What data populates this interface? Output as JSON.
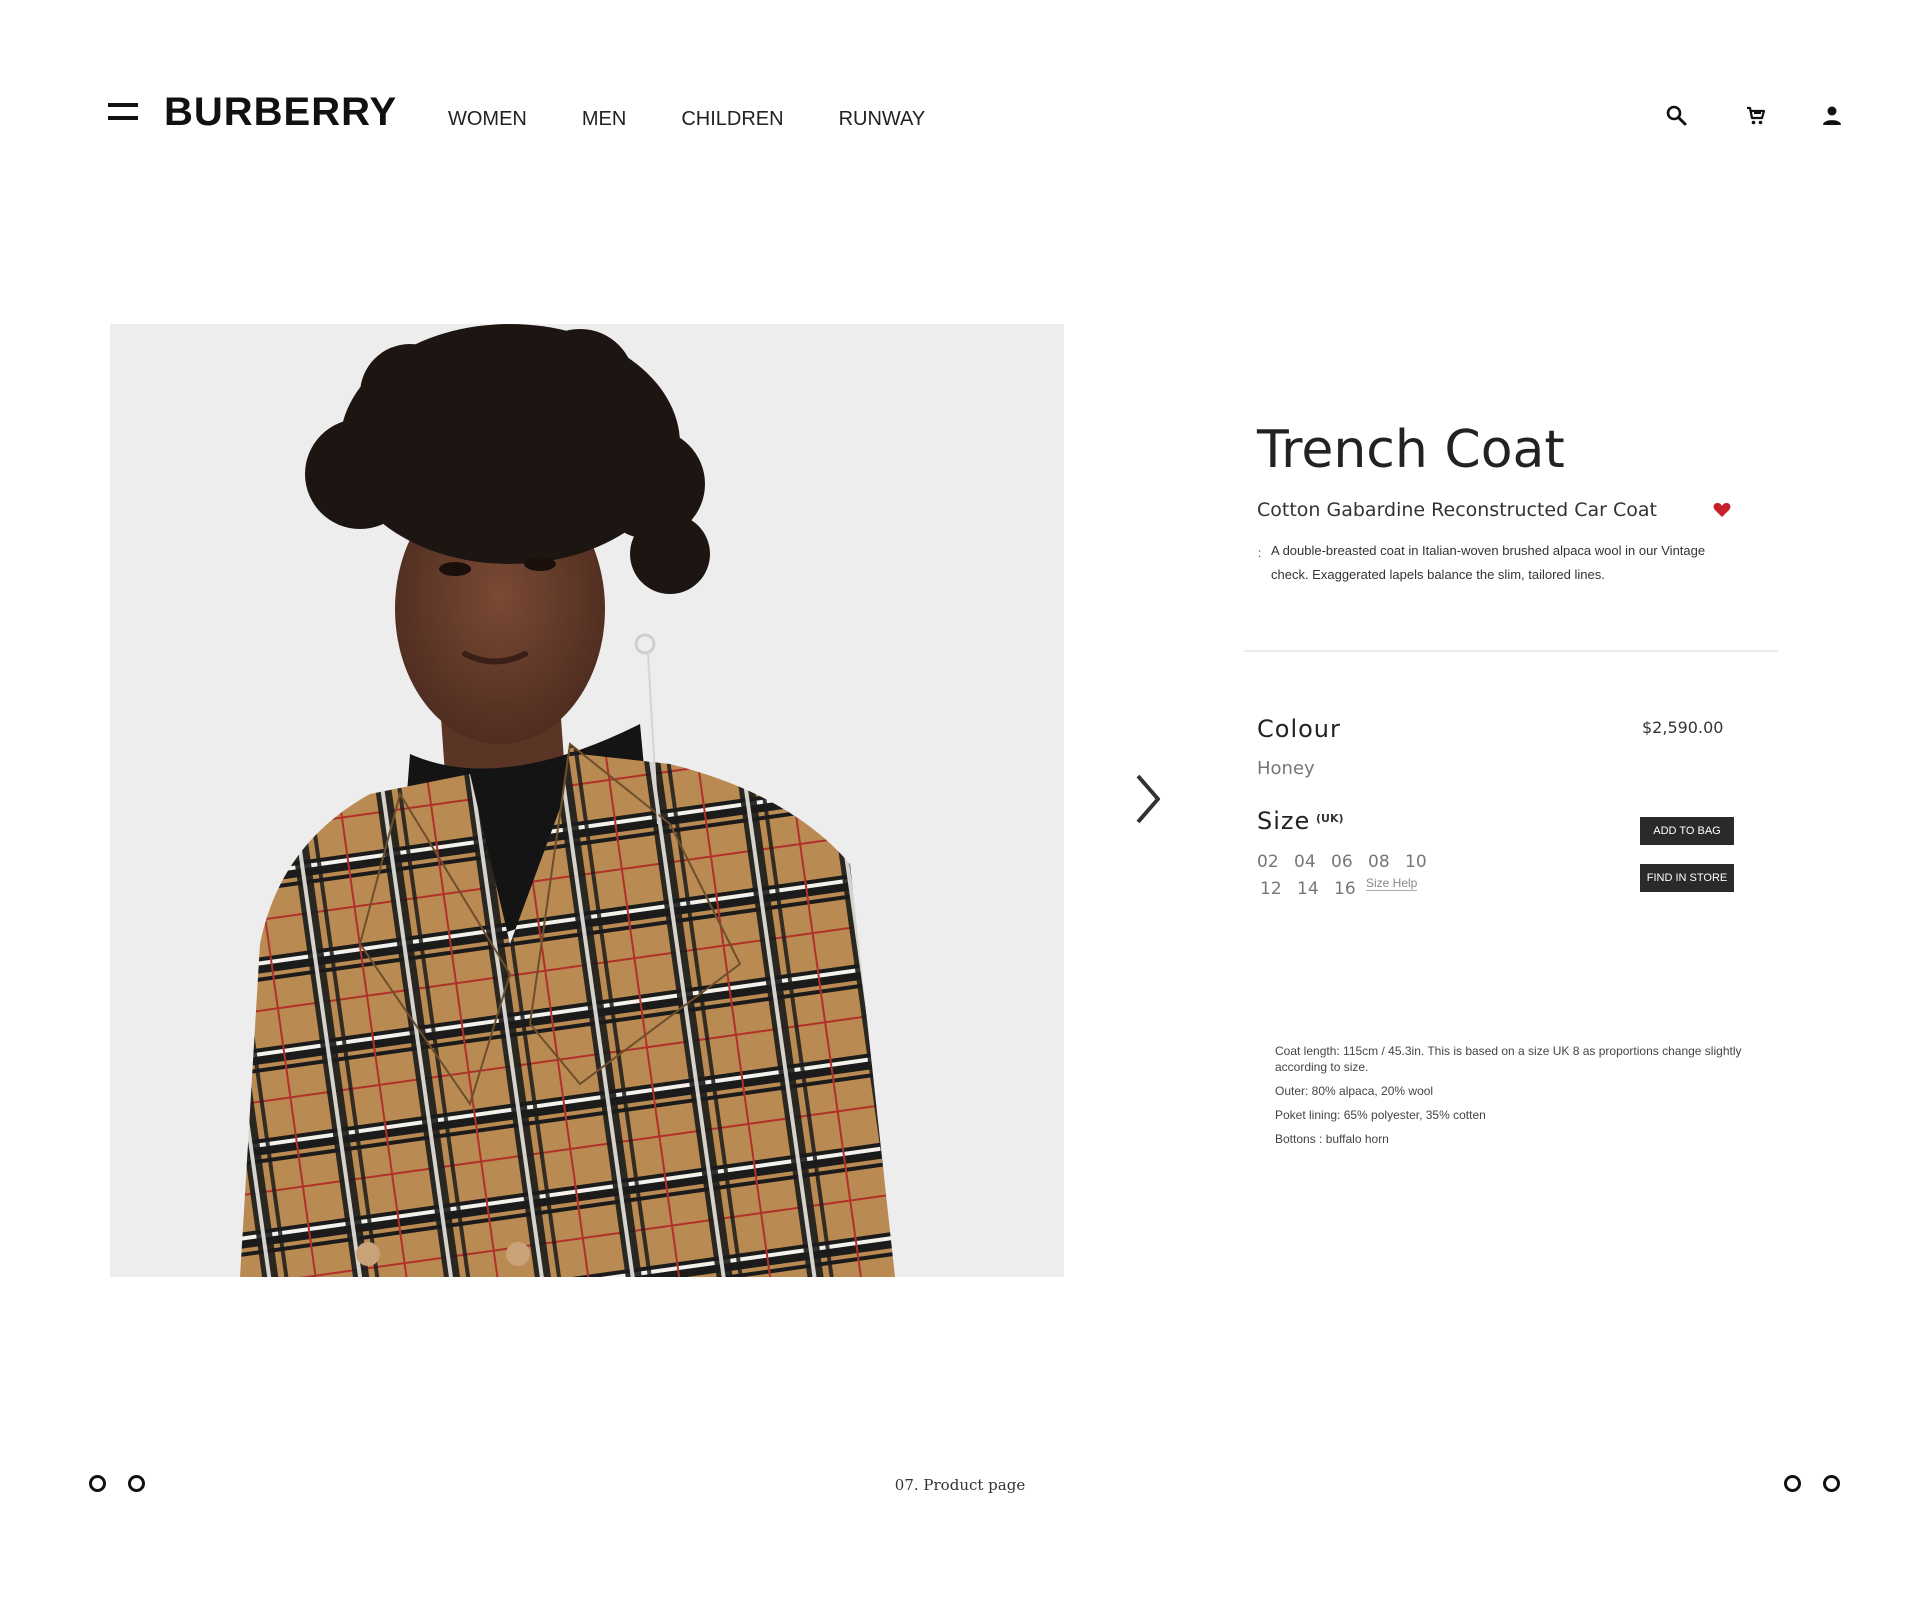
{
  "header": {
    "logo": "BURBERRY",
    "nav": [
      "WOMEN",
      "MEN",
      "CHILDREN",
      "RUNWAY"
    ],
    "icons": [
      "menu-icon",
      "search-icon",
      "cart-icon",
      "user-icon"
    ]
  },
  "product": {
    "title": "Trench Coat",
    "subtitle": "Cotton Gabardine Reconstructed Car Coat",
    "description_prefix": ":",
    "description": "A double-breasted coat in Italian-woven brushed alpaca wool in our Vintage check. Exaggerated lapels balance the slim, tailored lines.",
    "colour_label": "Colour",
    "colour_value": "Honey",
    "price": "$2,590.00",
    "size_label": "Size",
    "size_unit": "(UK)",
    "sizes": [
      "02",
      "04",
      "06",
      "08",
      "10",
      "12",
      "14",
      "16"
    ],
    "size_help": "Size Help",
    "add_to_bag": "ADD TO BAG",
    "find_in_store": "FIND IN STORE",
    "details": [
      "Coat length: 115cm / 45.3in. This is based on a size UK 8 as proportions change slightly according to size.",
      "Outer: 80% alpaca, 20% wool",
      "Poket lining: 65% polyester, 35% cotten",
      "Bottons : buffalo horn"
    ]
  },
  "footer": {
    "page_label": "07. Product page"
  },
  "colors": {
    "favorite": "#c8202a",
    "button_bg": "#2a2a2a",
    "photo_bg": "#ededed"
  }
}
